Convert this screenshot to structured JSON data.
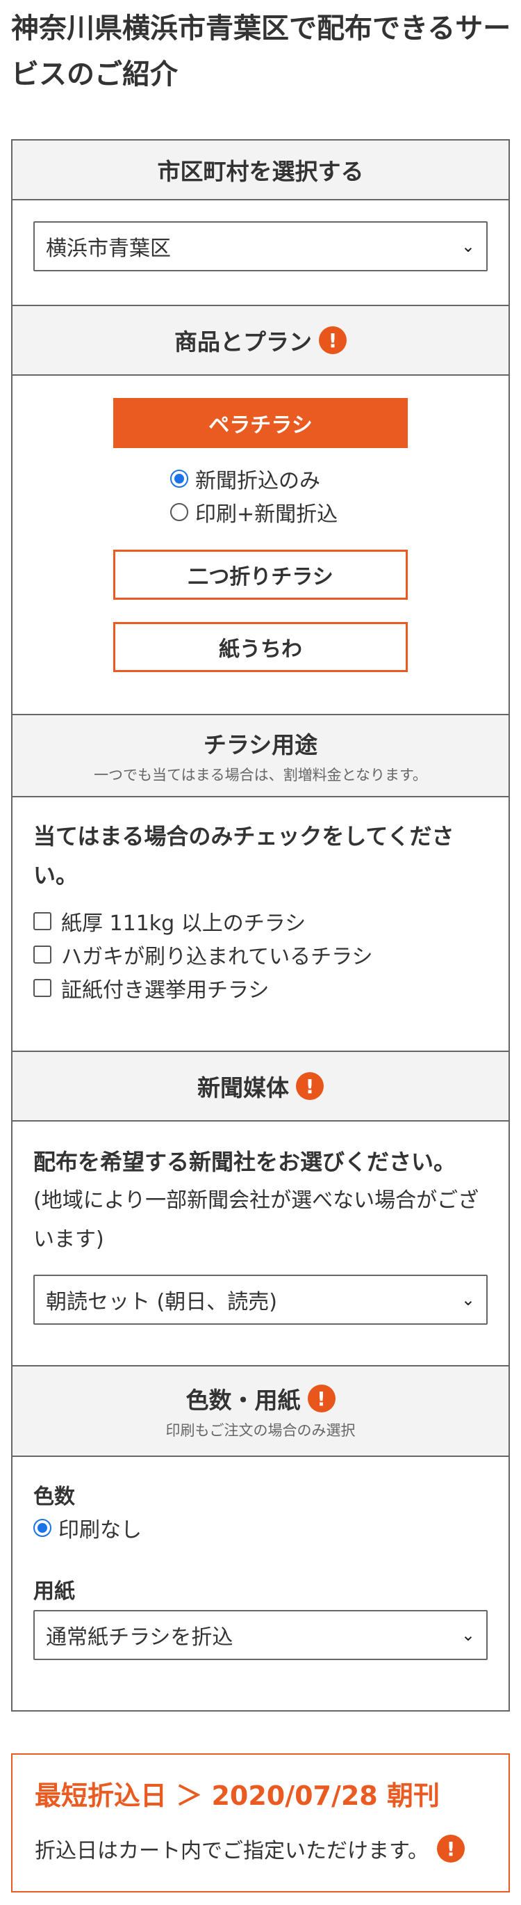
{
  "page": {
    "title": "神奈川県横浜市青葉区で配布できるサービスのご紹介"
  },
  "municipality": {
    "heading": "市区町村を選択する",
    "selected": "横浜市青葉区"
  },
  "plan": {
    "heading": "商品とプラン",
    "primary_button": "ペラチラシ",
    "radio_options": [
      "新聞折込のみ",
      "印刷+新聞折込"
    ],
    "selected_index": 0,
    "button_fold": "二つ折りチラシ",
    "button_fan": "紙うちわ"
  },
  "usage": {
    "heading": "チラシ用途",
    "subheading": "一つでも当てはまる場合は、割増料金となります。",
    "instruction": "当てはまる場合のみチェックをしてください。",
    "checks": [
      "紙厚 111kg 以上のチラシ",
      "ハガキが刷り込まれているチラシ",
      "証紙付き選挙用チラシ"
    ]
  },
  "newspaper": {
    "heading": "新聞媒体",
    "instruction": "配布を希望する新聞社をお選びください。",
    "note": "(地域により一部新聞会社が選べない場合がございます)",
    "selected": "朝読セット (朝日、読売)"
  },
  "color_paper": {
    "heading": "色数・用紙",
    "subheading": "印刷もご注文の場合のみ選択",
    "color_label": "色数",
    "color_option": "印刷なし",
    "paper_label": "用紙",
    "paper_selected": "通常紙チラシを折込"
  },
  "delivery": {
    "date_line": "最短折込日 ＞ 2020/07/28 朝刊",
    "note": "折込日はカート内でご指定いただけます。"
  },
  "colors": {
    "accent": "#ea5b22",
    "radio": "#1a73e8",
    "header_bg": "#f3f3f3"
  },
  "icons": {
    "warning": "exclamation-circle-icon",
    "select": "chevron-down-icon"
  }
}
